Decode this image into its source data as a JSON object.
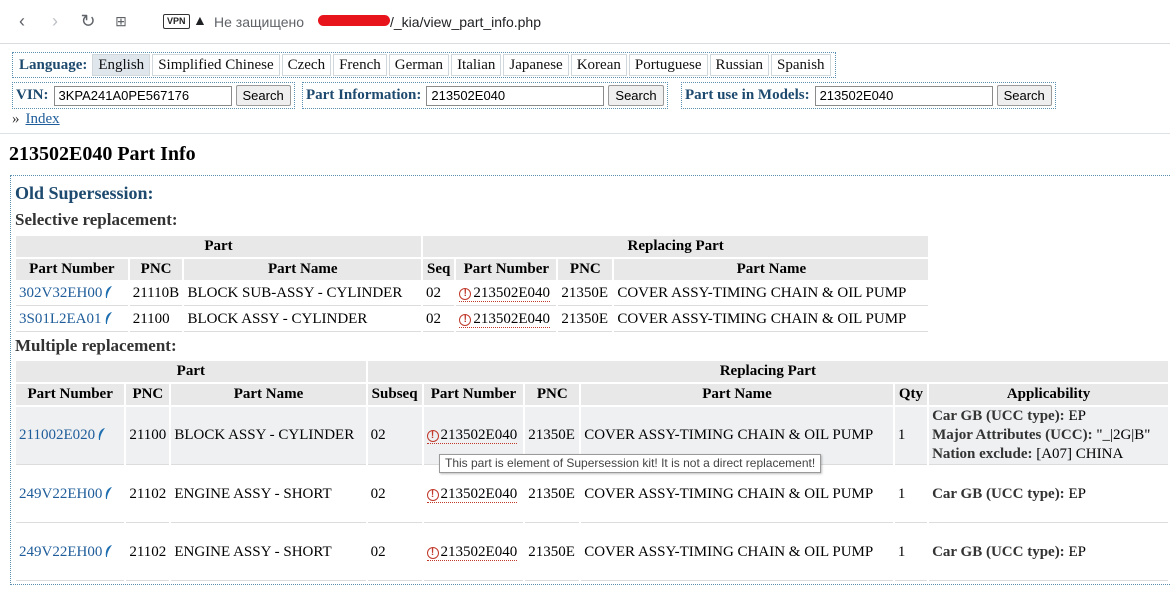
{
  "browser": {
    "vpn": "VPN",
    "insecure": "Не защищено",
    "url_tail": "/_kia/view_part_info.php"
  },
  "languages": {
    "title": "Language:",
    "items": [
      "English",
      "Simplified Chinese",
      "Czech",
      "French",
      "German",
      "Italian",
      "Japanese",
      "Korean",
      "Portuguese",
      "Russian",
      "Spanish"
    ],
    "active": "English"
  },
  "search": {
    "vin": {
      "label": "VIN:",
      "value": "3KPA241A0PE567176",
      "button": "Search"
    },
    "part_info": {
      "label": "Part Information:",
      "value": "213502E040",
      "button": "Search"
    },
    "part_use": {
      "label": "Part use in Models:",
      "value": "213502E040",
      "button": "Search"
    }
  },
  "breadcrumb": {
    "sep": "»",
    "index": "Index"
  },
  "page_title": "213502E040 Part Info",
  "old_supersession": {
    "title": "Old Supersession:",
    "selective": {
      "title": "Selective replacement:",
      "group_part": "Part",
      "group_replacing": "Replacing Part",
      "headers": [
        "Part Number",
        "PNC",
        "Part Name",
        "Seq",
        "Part Number",
        "PNC",
        "Part Name"
      ],
      "rows": [
        {
          "pn": "302V32EH00",
          "pnc": "21110B",
          "name": "BLOCK SUB-ASSY - CYLINDER",
          "seq": "02",
          "rpn": "213502E040",
          "rpnc": "21350E",
          "rname": "COVER ASSY-TIMING CHAIN & OIL PUMP"
        },
        {
          "pn": "3S01L2EA01",
          "pnc": "21100",
          "name": "BLOCK ASSY - CYLINDER",
          "seq": "02",
          "rpn": "213502E040",
          "rpnc": "21350E",
          "rname": "COVER ASSY-TIMING CHAIN & OIL PUMP"
        }
      ]
    },
    "multiple": {
      "title": "Multiple replacement:",
      "group_part": "Part",
      "group_replacing": "Replacing Part",
      "headers": [
        "Part Number",
        "PNC",
        "Part Name",
        "Subseq",
        "Part Number",
        "PNC",
        "Part Name",
        "Qty",
        "Applicability"
      ],
      "rows": [
        {
          "pn": "211002E020",
          "pnc": "21100",
          "name": "BLOCK ASSY - CYLINDER",
          "subseq": "02",
          "rpn": "213502E040",
          "rpnc": "21350E",
          "rname": "COVER ASSY-TIMING CHAIN & OIL PUMP",
          "qty": "1",
          "app": [
            {
              "label": "Car GB (UCC type):",
              "value": "EP"
            },
            {
              "label": "Major Attributes (UCC):",
              "value": "\"_|2G|B\""
            },
            {
              "label": "Nation exclude:",
              "value": "[A07] CHINA"
            }
          ]
        },
        {
          "pn": "249V22EH00",
          "pnc": "21102",
          "name": "ENGINE ASSY - SHORT",
          "subseq": "02",
          "rpn": "213502E040",
          "rpnc": "21350E",
          "rname": "COVER ASSY-TIMING CHAIN & OIL PUMP",
          "qty": "1",
          "app": [
            {
              "label": "Car GB (UCC type):",
              "value": "EP"
            }
          ]
        },
        {
          "pn": "249V22EH00",
          "pnc": "21102",
          "name": "ENGINE ASSY - SHORT",
          "subseq": "02",
          "rpn": "213502E040",
          "rpnc": "21350E",
          "rname": "COVER ASSY-TIMING CHAIN & OIL PUMP",
          "qty": "1",
          "app": [
            {
              "label": "Car GB (UCC type):",
              "value": "EP"
            }
          ]
        }
      ]
    }
  },
  "tooltip": "This part is element of Supersession kit! It is not a direct replacement!"
}
